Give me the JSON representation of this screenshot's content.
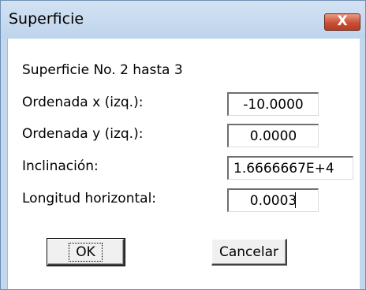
{
  "window": {
    "title": "Superficie",
    "close_glyph": "X"
  },
  "dialog": {
    "heading": "Superficie No. 2 hasta 3",
    "fields": [
      {
        "label": "Ordenada x (izq.):",
        "value": "-10.0000"
      },
      {
        "label": "Ordenada y (izq.):",
        "value": "0.0000"
      },
      {
        "label": "Inclinación:",
        "value": "1.6666667E+4"
      },
      {
        "label": "Longitud horizontal:",
        "value": "0.0003"
      }
    ],
    "ok_label": "OK",
    "cancel_label": "Cancelar"
  },
  "colors": {
    "frame": "#c2d7ee",
    "close_button": "#c85035"
  }
}
